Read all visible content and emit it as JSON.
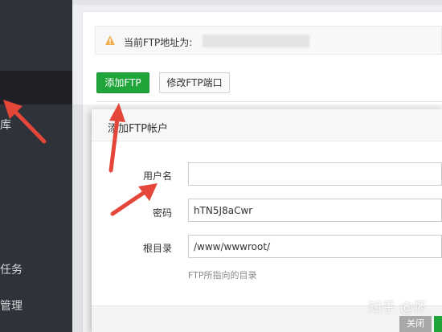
{
  "sidebar": {
    "items": [
      {
        "label": "库"
      },
      {
        "label": "任务"
      },
      {
        "label": "管理"
      }
    ]
  },
  "main": {
    "notice": {
      "label": "当前FTP地址为:"
    },
    "buttons": {
      "add_ftp": "添加FTP",
      "modify_port": "修改FTP端口"
    }
  },
  "dialog": {
    "title": "添加FTP帐户",
    "fields": {
      "username": {
        "label": "用户名",
        "value": ""
      },
      "password": {
        "label": "密码",
        "value": "hTN5J8aCwr"
      },
      "root": {
        "label": "根目录",
        "value": "/www/wwwroot/",
        "hint": "FTP所指向的目录"
      }
    },
    "footer": {
      "close_label": "关闭"
    }
  },
  "watermark": {
    "text": "知乎 @怀"
  },
  "colors": {
    "primary": "#20a53a",
    "sidebar": "#2f3238",
    "arrow": "#e4463a",
    "warning": "#f0ad4e"
  },
  "icons": {
    "warning": "warning-triangle-icon"
  }
}
